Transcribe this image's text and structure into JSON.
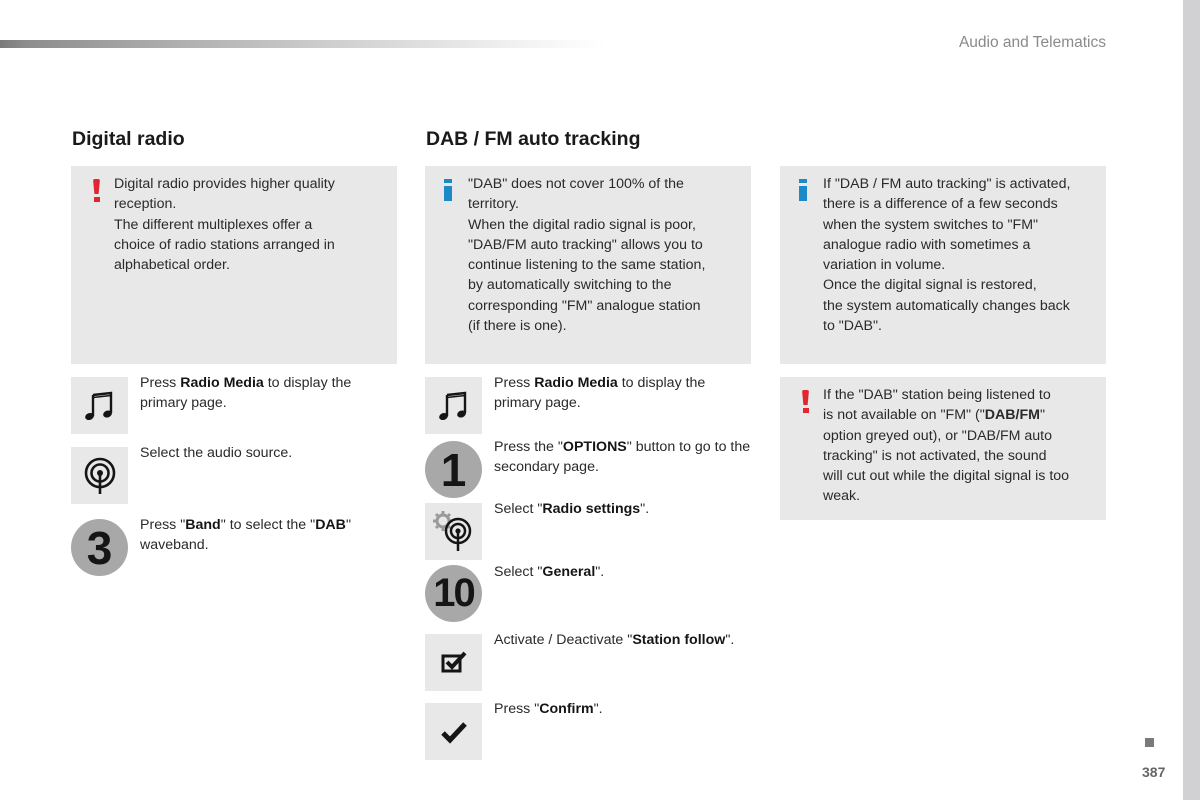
{
  "header": {
    "section_label": "Audio and Telematics"
  },
  "colors": {
    "warning_red": "#e0262f",
    "info_blue": "#1d8ac8",
    "note_bg": "#e8e8e8",
    "step_circle": "#a8a8a8"
  },
  "left_column": {
    "heading": "Digital radio",
    "note": {
      "icon": "exclamation-icon",
      "lines": [
        "Digital radio provides higher quality",
        "reception.",
        "The different multiplexes offer a",
        "choice of radio stations arranged in",
        "alphabetical order."
      ]
    },
    "steps": [
      {
        "icon": "music-note-icon",
        "parts": [
          [
            "Press ",
            false
          ],
          [
            "Radio Media",
            true
          ],
          [
            " to display the primary page.",
            false
          ]
        ]
      },
      {
        "icon": "radio-antenna-icon",
        "parts": [
          [
            "Select the audio source.",
            false
          ]
        ]
      },
      {
        "icon": "number-3-badge",
        "badge": "3",
        "parts": [
          [
            "Press \"",
            false
          ],
          [
            "Band",
            true
          ],
          [
            "\" to select the \"",
            false
          ],
          [
            "DAB",
            true
          ],
          [
            "\" waveband.",
            false
          ]
        ]
      }
    ]
  },
  "middle_column": {
    "heading": "DAB / FM auto tracking",
    "note": {
      "icon": "info-icon",
      "lines": [
        "\"DAB\" does not cover 100% of the",
        "territory.",
        "When the digital radio signal is poor,",
        "\"DAB/FM auto tracking\" allows you to",
        "continue listening to the same station,",
        "by automatically switching to the",
        "corresponding \"FM\" analogue station",
        "(if there is one)."
      ]
    },
    "steps": [
      {
        "icon": "music-note-icon",
        "parts": [
          [
            "Press ",
            false
          ],
          [
            "Radio Media",
            true
          ],
          [
            " to display the primary page.",
            false
          ]
        ]
      },
      {
        "icon": "number-1-badge",
        "badge": "1",
        "parts": [
          [
            "Press the \"",
            false
          ],
          [
            "OPTIONS",
            true
          ],
          [
            "\" button to go to the secondary page.",
            false
          ]
        ]
      },
      {
        "icon": "radio-settings-icon",
        "parts": [
          [
            "Select \"",
            false
          ],
          [
            "Radio settings",
            true
          ],
          [
            "\".",
            false
          ]
        ]
      },
      {
        "icon": "number-10-badge",
        "badge": "10",
        "parts": [
          [
            "Select \"",
            false
          ],
          [
            "General",
            true
          ],
          [
            "\".",
            false
          ]
        ]
      },
      {
        "icon": "checkbox-icon",
        "parts": [
          [
            "Activate / Deactivate \"",
            false
          ],
          [
            "Station follow",
            true
          ],
          [
            "\".",
            false
          ]
        ]
      },
      {
        "icon": "checkmark-icon",
        "parts": [
          [
            "Press \"",
            false
          ],
          [
            "Confirm",
            true
          ],
          [
            "\".",
            false
          ]
        ]
      }
    ]
  },
  "right_column": {
    "info_note": {
      "icon": "info-icon",
      "lines": [
        "If \"DAB / FM auto tracking\" is activated,",
        "there is a difference of a few seconds",
        "when the system switches to \"FM\"",
        "analogue radio with sometimes a",
        "variation in volume.",
        "Once the digital signal is restored,",
        "the system automatically changes back",
        "to \"DAB\"."
      ]
    },
    "warning_note": {
      "icon": "exclamation-icon",
      "parts": [
        [
          "If the \"DAB\" station being listened to",
          false
        ],
        [
          "\n",
          false
        ],
        [
          "is not available on \"FM\" (\"",
          false
        ],
        [
          "DAB/FM",
          true
        ],
        [
          "\"",
          false
        ],
        [
          "\n",
          false
        ],
        [
          "option greyed out), or \"DAB/FM auto",
          false
        ],
        [
          "\n",
          false
        ],
        [
          "tracking\" is not activated, the sound",
          false
        ],
        [
          "\n",
          false
        ],
        [
          "will cut out while the digital signal is too",
          false
        ],
        [
          "\n",
          false
        ],
        [
          "weak.",
          false
        ]
      ]
    }
  },
  "footer": {
    "page_number": "387"
  }
}
